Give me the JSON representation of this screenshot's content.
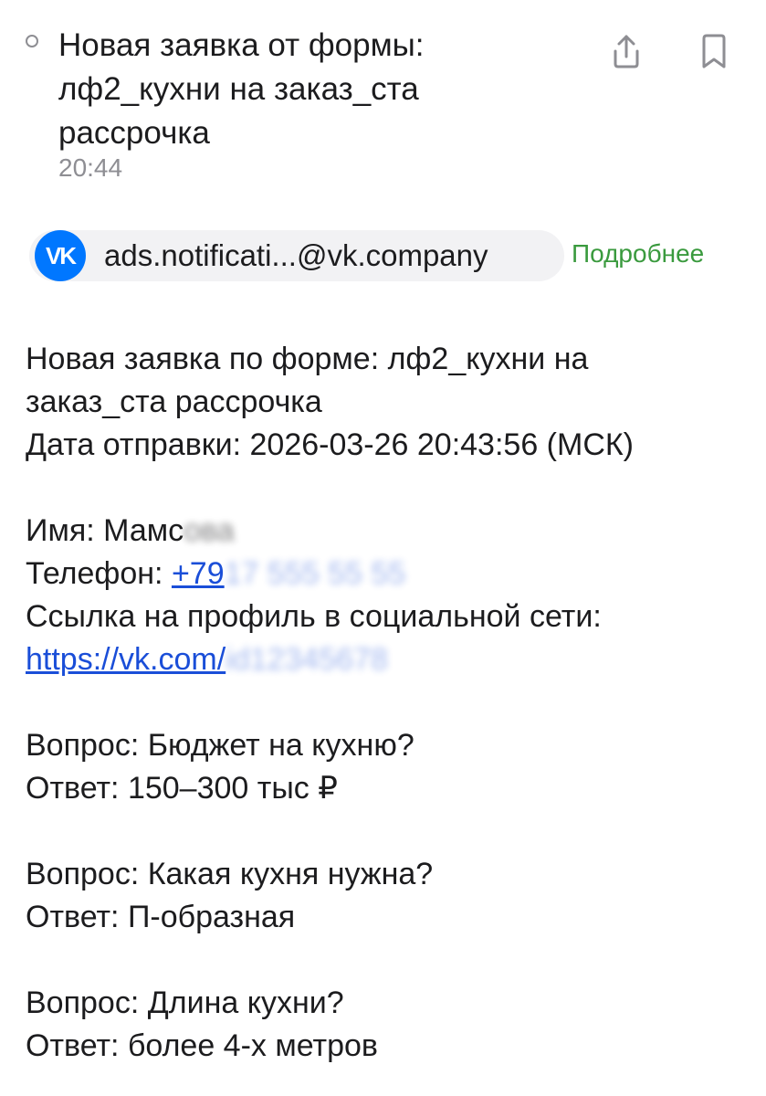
{
  "header": {
    "subject_lines": [
      "Новая заявка от формы:",
      "лф2_кухни на заказ_ста",
      "рассрочка"
    ],
    "time": "20:44",
    "share_icon": "share-icon",
    "bookmark_icon": "bookmark-icon"
  },
  "sender": {
    "logo_text": "VK",
    "email": "ads.notificati...@vk.company",
    "more_label": "Подробнее",
    "accent": "#0077ff",
    "more_color": "#3a9a3e"
  },
  "message": {
    "form_line_1": "Новая заявка по форме: лф2_кухни на",
    "form_line_2": "заказ_ста рассрочка",
    "date_line": "Дата отправки: 2026-03-26 20:43:56 (МСК)",
    "name_label": "Имя: ",
    "name_value": "Мамс",
    "phone_label": "Телефон: ",
    "phone_value": "+79",
    "profile_label": "Ссылка на профиль в социальной сети:",
    "profile_link": "https://vk.com/",
    "qa": [
      {
        "question": "Вопрос: Бюджет на кухню?",
        "answer": "Ответ: 150–300 тыс ₽"
      },
      {
        "question": "Вопрос: Какая кухня нужна?",
        "answer": "Ответ: П-образная"
      },
      {
        "question": "Вопрос: Длина кухни?",
        "answer": "Ответ: более 4-х метров"
      }
    ]
  }
}
